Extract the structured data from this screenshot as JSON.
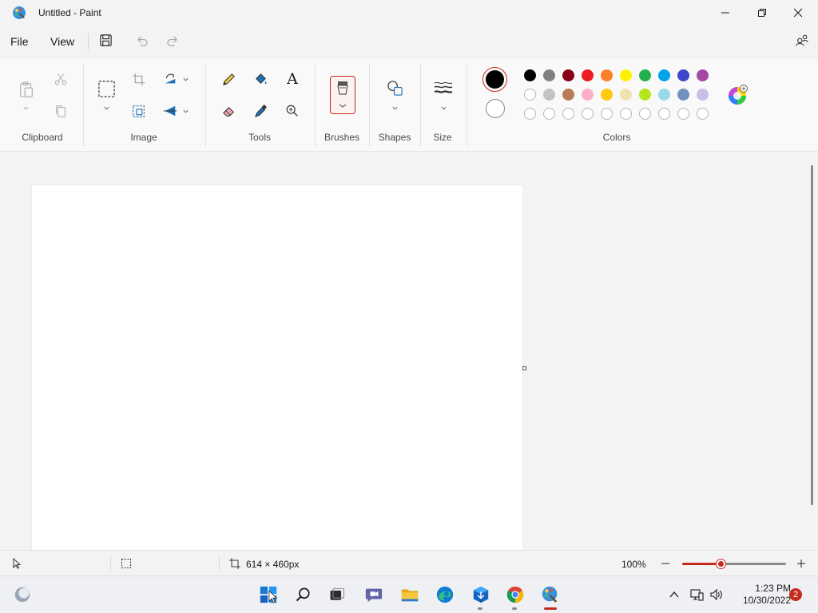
{
  "window": {
    "title": "Untitled - Paint",
    "icons": {
      "app": "paint-app-icon",
      "minimize": "minimize-icon",
      "maximize": "restore-icon",
      "close": "close-icon"
    }
  },
  "menu": {
    "file_label": "File",
    "view_label": "View",
    "icons": [
      "save-icon",
      "undo-icon",
      "redo-icon",
      "share-icon"
    ]
  },
  "ribbon": {
    "groups": {
      "clipboard": "Clipboard",
      "image": "Image",
      "tools": "Tools",
      "brushes": "Brushes",
      "shapes": "Shapes",
      "size": "Size",
      "colors": "Colors"
    },
    "text_tool_glyph": "A",
    "accent_color": "#c42b1c",
    "primary_color": "#000000",
    "secondary_color": "#ffffff",
    "palette_row1": [
      "#000000",
      "#7f7f7f",
      "#880015",
      "#ed1c24",
      "#ff7f27",
      "#fff200",
      "#22b14c",
      "#00a2e8",
      "#3f48cc",
      "#a349a4"
    ],
    "palette_row2": [
      "#ffffff",
      "#c3c3c3",
      "#b97a57",
      "#ffaec9",
      "#ffc90e",
      "#efe4b0",
      "#b5e61d",
      "#99d9ea",
      "#7092be",
      "#c8bfe7"
    ],
    "palette_row3_empty_count": 10
  },
  "status": {
    "canvas_size": "614 × 460px",
    "zoom": "100%",
    "zoom_fraction": 0.38
  },
  "taskbar": {
    "apps": [
      "widgets-icon",
      "start-icon",
      "search-icon",
      "task-view-icon",
      "teams-chat-icon",
      "file-explorer-icon",
      "edge-icon",
      "app-installer-icon",
      "chrome-icon",
      "paint-icon"
    ],
    "time": "1:23 PM",
    "date": "10/30/2022",
    "notification_count": "2"
  }
}
